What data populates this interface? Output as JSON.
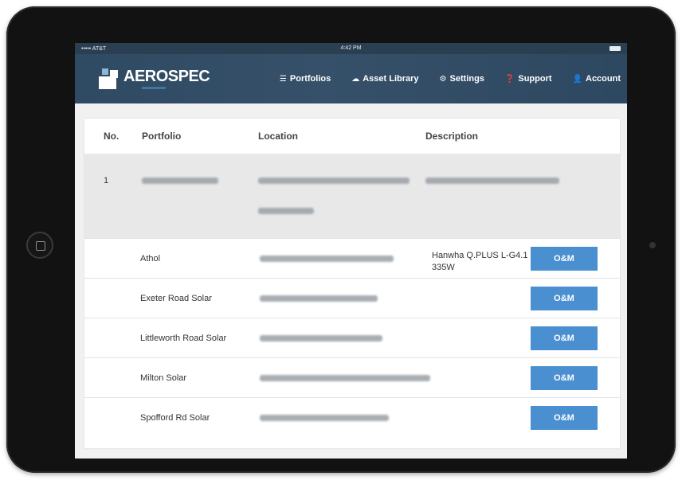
{
  "statusbar": {
    "carrier": "••••• AT&T",
    "time": "4:42 PM"
  },
  "brand": {
    "name": "AEROSPEC"
  },
  "nav": [
    {
      "label": "Portfolios",
      "icon": "list-icon",
      "glyph": "☰"
    },
    {
      "label": "Asset Library",
      "icon": "cloud-icon",
      "glyph": "☁"
    },
    {
      "label": "Settings",
      "icon": "gear-icon",
      "glyph": "⚙"
    },
    {
      "label": "Support",
      "icon": "question-icon",
      "glyph": "❓"
    },
    {
      "label": "Account",
      "icon": "user-icon",
      "glyph": "👤"
    }
  ],
  "table": {
    "headers": {
      "no": "No.",
      "portfolio": "Portfolio",
      "location": "Location",
      "description": "Description"
    },
    "portfolio_row": {
      "no": "1"
    },
    "sites": [
      {
        "name": "Athol",
        "description": "Hanwha Q.PLUS L-G4.1 335W",
        "button": "O&M"
      },
      {
        "name": "Exeter Road Solar",
        "description": "",
        "button": "O&M"
      },
      {
        "name": "Littleworth Road Solar",
        "description": "",
        "button": "O&M"
      },
      {
        "name": "Milton Solar",
        "description": "",
        "button": "O&M"
      },
      {
        "name": "Spofford Rd Solar",
        "description": "",
        "button": "O&M"
      }
    ]
  },
  "colors": {
    "navbar": "#2f4a63",
    "button": "#4a90d0",
    "highlight_row": "#e8e8e8"
  }
}
